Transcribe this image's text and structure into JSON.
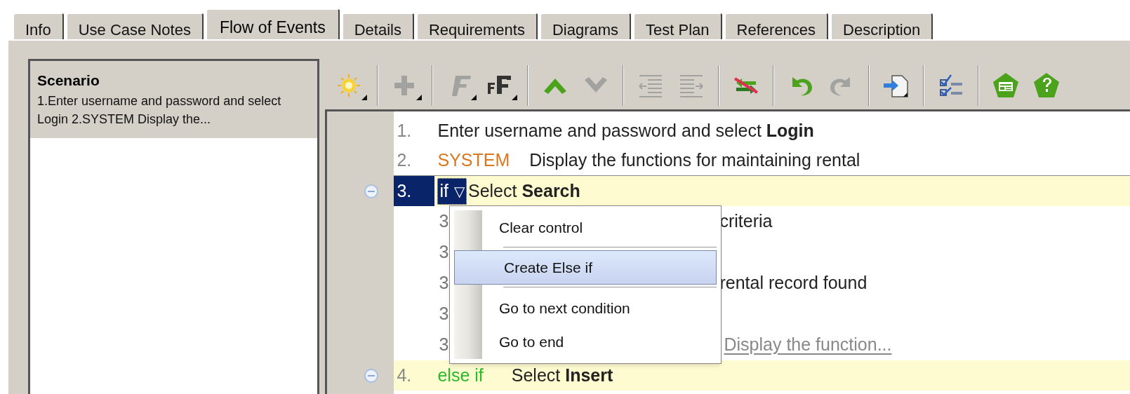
{
  "tabs": [
    {
      "label": "Info",
      "selected": false
    },
    {
      "label": "Use Case Notes",
      "selected": false
    },
    {
      "label": "Flow of Events",
      "selected": true
    },
    {
      "label": "Details",
      "selected": false
    },
    {
      "label": "Requirements",
      "selected": false
    },
    {
      "label": "Diagrams",
      "selected": false
    },
    {
      "label": "Test Plan",
      "selected": false
    },
    {
      "label": "References",
      "selected": false
    },
    {
      "label": "Description",
      "selected": false
    }
  ],
  "scenarios": [
    {
      "title": "Scenario",
      "summary": "1.Enter username and password and select Login 2.SYSTEM Display the...",
      "selected": true
    }
  ],
  "toolbar": [
    {
      "kind": "sun",
      "dropdown": true,
      "disabled": false
    },
    {
      "kind": "separator"
    },
    {
      "kind": "plus",
      "dropdown": true,
      "disabled": true
    },
    {
      "kind": "separator"
    },
    {
      "kind": "italic-f",
      "dropdown": true,
      "disabled": true
    },
    {
      "kind": "font-f",
      "dropdown": true,
      "disabled": false
    },
    {
      "kind": "separator"
    },
    {
      "kind": "up",
      "dropdown": false,
      "disabled": false
    },
    {
      "kind": "down",
      "dropdown": false,
      "disabled": true
    },
    {
      "kind": "separator"
    },
    {
      "kind": "outdent",
      "dropdown": false,
      "disabled": true
    },
    {
      "kind": "indent",
      "dropdown": false,
      "disabled": true
    },
    {
      "kind": "separator"
    },
    {
      "kind": "swap",
      "dropdown": false,
      "disabled": false
    },
    {
      "kind": "separator"
    },
    {
      "kind": "undo",
      "dropdown": false,
      "disabled": false
    },
    {
      "kind": "redo",
      "dropdown": false,
      "disabled": true
    },
    {
      "kind": "separator"
    },
    {
      "kind": "import",
      "dropdown": false,
      "disabled": false
    },
    {
      "kind": "separator"
    },
    {
      "kind": "checklist",
      "dropdown": false,
      "disabled": false
    },
    {
      "kind": "separator"
    },
    {
      "kind": "form",
      "dropdown": false,
      "disabled": false
    },
    {
      "kind": "help",
      "dropdown": false,
      "disabled": false
    }
  ],
  "steps": [
    {
      "kind": "step",
      "number": "1.",
      "text": "Enter username and password and select **Login**",
      "selected": false
    },
    {
      "kind": "step",
      "number": "2.",
      "actor": "SYSTEM",
      "text": "Display the functions for maintaining rental",
      "selected": false
    },
    {
      "kind": "condition",
      "number": "3.",
      "keyword": "if",
      "keyword_menu": "▽",
      "text": "Select **Search**",
      "selected": true,
      "expanded": true
    },
    {
      "kind": "sub",
      "number": "3",
      "text": "criteria",
      "selected": false
    },
    {
      "kind": "sub",
      "number": "3",
      "selected": false
    },
    {
      "kind": "sub",
      "number": "3",
      "text": "rental record found",
      "selected": false
    },
    {
      "kind": "sub",
      "number": "3",
      "selected": false
    },
    {
      "kind": "reference",
      "number": "3",
      "text": "Display the function...",
      "selected": false
    },
    {
      "kind": "condition",
      "number": "4.",
      "keyword": "else if",
      "text": "Select **Insert**",
      "selected": false,
      "expanded": true
    }
  ],
  "context_menu": [
    {
      "kind": "item",
      "label": "Clear control",
      "selected": false
    },
    {
      "kind": "separator"
    },
    {
      "kind": "item",
      "label": "Create Else if",
      "selected": true
    },
    {
      "kind": "separator"
    },
    {
      "kind": "item",
      "label": "Go to next condition",
      "selected": false
    },
    {
      "kind": "item",
      "label": "Go to end",
      "selected": false
    }
  ]
}
